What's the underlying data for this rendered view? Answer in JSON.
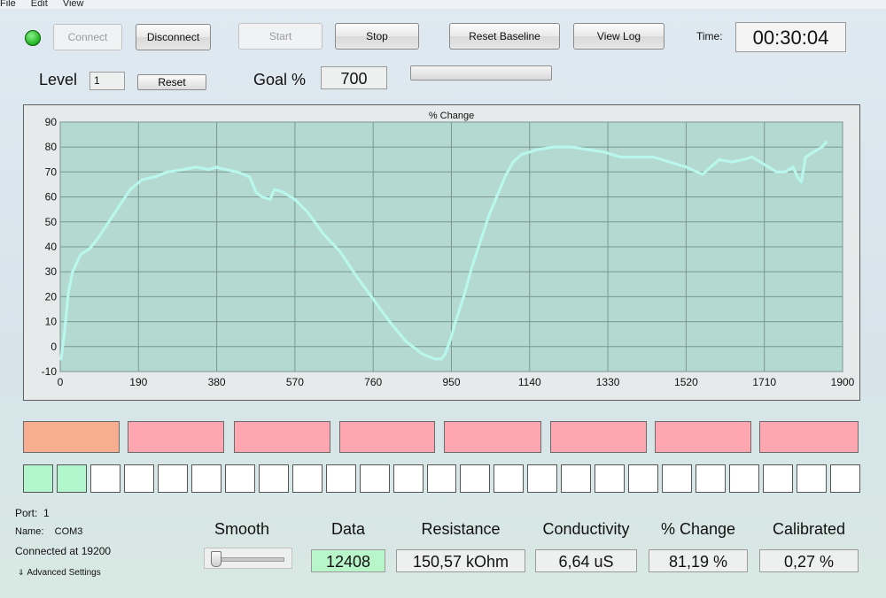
{
  "menu": [
    "File",
    "Edit",
    "View"
  ],
  "toolbar": {
    "connect": "Connect",
    "disconnect": "Disconnect",
    "start": "Start",
    "stop": "Stop",
    "reset_baseline": "Reset Baseline",
    "view_log": "View Log",
    "time_label": "Time:",
    "time_value": "00:30:04",
    "status_color": "#1fb31f"
  },
  "level": {
    "label": "Level",
    "value": "1",
    "reset": "Reset"
  },
  "goal": {
    "label": "Goal %",
    "value": "700",
    "progress": 0
  },
  "chart_data": {
    "type": "line",
    "title": "% Change",
    "xlabel": "",
    "ylabel": "",
    "xlim": [
      0,
      1900
    ],
    "ylim": [
      -10,
      90
    ],
    "xticks": [
      0,
      190,
      380,
      570,
      760,
      950,
      1140,
      1330,
      1520,
      1710,
      1900
    ],
    "yticks": [
      -10,
      0,
      10,
      20,
      30,
      40,
      50,
      60,
      70,
      80,
      90
    ],
    "grid": true,
    "background": "#b3d9d0",
    "line_color": "#b9f7ec",
    "series": [
      {
        "x": [
          2,
          10,
          20,
          30,
          50,
          70,
          90,
          110,
          130,
          150,
          170,
          200,
          230,
          260,
          300,
          330,
          360,
          380,
          400,
          430,
          460,
          475,
          490,
          510,
          520,
          540,
          570,
          600,
          640,
          680,
          720,
          760,
          800,
          840,
          880,
          910,
          925,
          935,
          950,
          960,
          980,
          1000,
          1020,
          1040,
          1060,
          1080,
          1100,
          1120,
          1140,
          1160,
          1200,
          1240,
          1280,
          1320,
          1360,
          1400,
          1440,
          1480,
          1520,
          1560,
          1580,
          1600,
          1630,
          1660,
          1680,
          1700,
          1720,
          1740,
          1760,
          1780,
          1790,
          1800,
          1810,
          1830,
          1850,
          1860
        ],
        "y": [
          -5,
          5,
          22,
          30,
          37,
          39,
          43,
          48,
          53,
          58,
          63,
          67,
          68,
          70,
          71,
          72,
          71,
          72,
          71,
          70,
          68,
          62,
          60,
          59,
          63,
          62,
          59,
          54,
          45,
          38,
          28,
          19,
          10,
          2,
          -3,
          -5,
          -5,
          -3,
          4,
          10,
          20,
          32,
          42,
          52,
          60,
          68,
          74,
          77,
          78,
          79,
          80,
          80,
          79,
          78,
          76,
          76,
          76,
          74,
          72,
          69,
          72,
          75,
          74,
          75,
          76,
          74,
          72,
          70,
          70,
          72,
          68,
          66,
          76,
          78,
          80,
          82
        ]
      }
    ]
  },
  "tiles": [
    {
      "color": "#f7ad8f"
    },
    {
      "color": "#ffa7b1"
    },
    {
      "color": "#ffa7b1"
    },
    {
      "color": "#ffa7b1"
    },
    {
      "color": "#ffa7b1"
    },
    {
      "color": "#ffa7b1"
    },
    {
      "color": "#ffa7b1"
    },
    {
      "color": "#ffa7b1"
    }
  ],
  "cells": {
    "count": 25,
    "filled": 2,
    "filled_color": "#b1f6cc",
    "empty_color": "#ffffff"
  },
  "connection": {
    "port_label": "Port:",
    "port_value": "1",
    "name_label": "Name:",
    "name_value": "COM3",
    "status": "Connected at 19200",
    "advanced": "Advanced Settings"
  },
  "readouts": {
    "smooth_label": "Smooth",
    "smooth_level": 0,
    "data_label": "Data",
    "data_value": "12408",
    "data_bg": "#b8f5c8",
    "resistance_label": "Resistance",
    "resistance_value": "150,57 kOhm",
    "conductivity_label": "Conductivity",
    "conductivity_value": "6,64 uS",
    "pct_change_label": "% Change",
    "pct_change_value": "81,19 %",
    "calibrated_label": "Calibrated",
    "calibrated_value": "0,27 %"
  }
}
